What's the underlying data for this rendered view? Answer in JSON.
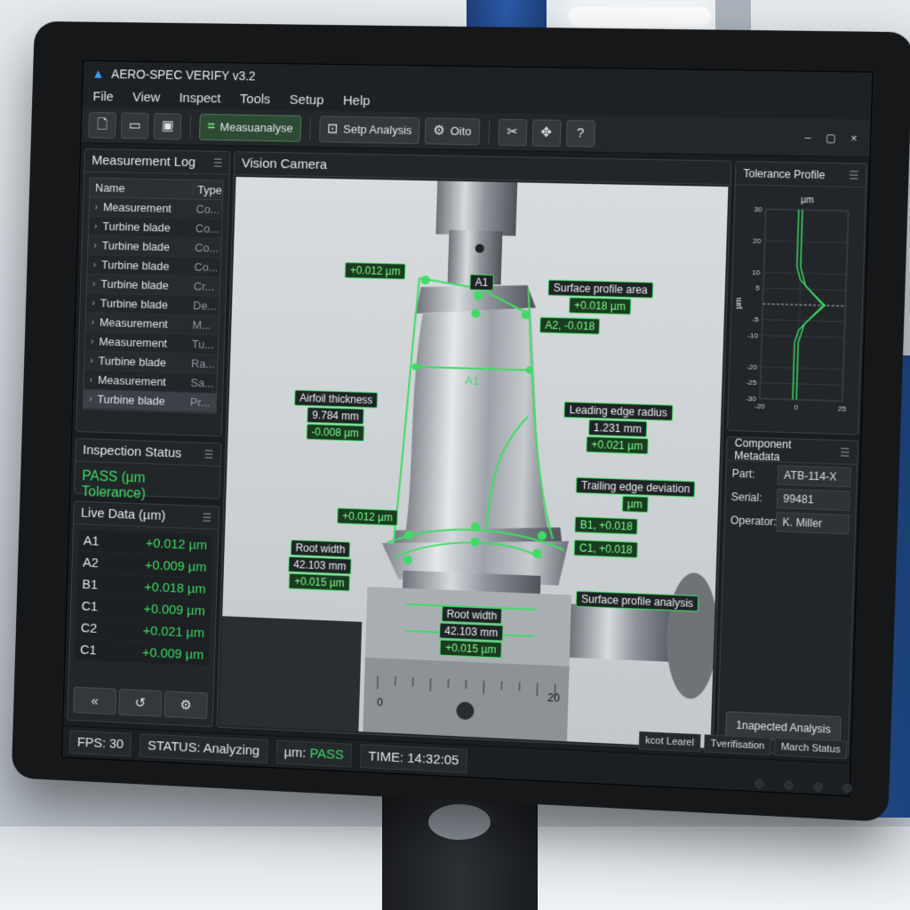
{
  "app": {
    "title": "AERO-SPEC VERIFY v3.2"
  },
  "menu": [
    "File",
    "View",
    "Inspect",
    "Tools",
    "Setup",
    "Help"
  ],
  "toolbar": {
    "measure_label": "Measuanalyse",
    "setup_label": "Setp Analysis",
    "auto_label": "Oito"
  },
  "window_controls": {
    "minimize": "–",
    "maximize": "▢",
    "close": "×"
  },
  "measurement_log": {
    "title": "Measurement Log",
    "col_name": "Name",
    "col_type": "Type",
    "rows": [
      {
        "name": "Measurement",
        "type": "Co..."
      },
      {
        "name": "Turbine blade",
        "type": "Co..."
      },
      {
        "name": "Turbine blade",
        "type": "Co..."
      },
      {
        "name": "Turbine blade",
        "type": "Co..."
      },
      {
        "name": "Turbine blade",
        "type": "Cr..."
      },
      {
        "name": "Turbine blade",
        "type": "De..."
      },
      {
        "name": "Measurement",
        "type": "M..."
      },
      {
        "name": "Measurement",
        "type": "Tu..."
      },
      {
        "name": "Turbine blade",
        "type": "Ra..."
      },
      {
        "name": "Measurement",
        "type": "Sa..."
      },
      {
        "name": "Turbine blade",
        "type": "Pr..."
      }
    ]
  },
  "inspection_status": {
    "title": "Inspection Status",
    "value": "PASS (µm Tolerance)"
  },
  "live_data": {
    "title": "Live Data (µm)",
    "rows": [
      {
        "key": "A1",
        "value": "+0.012 µm"
      },
      {
        "key": "A2",
        "value": "+0.009 µm"
      },
      {
        "key": "B1",
        "value": "+0.018 µm"
      },
      {
        "key": "C1",
        "value": "+0.009 µm"
      },
      {
        "key": "C2",
        "value": "+0.021 µm"
      },
      {
        "key": "C1",
        "value": "+0.009 µm"
      }
    ]
  },
  "camera": {
    "title": "Vision Camera",
    "annotations": {
      "a1_dev": "+0.012 µm",
      "a1_label": "A1",
      "a1_mid": "A1",
      "surface_area_title": "Surface profile area",
      "surface_area_val": "+0.018 µm",
      "a2": "A2, -0.018",
      "airfoil_title": "Airfoil thickness",
      "airfoil_mm": "9.784 mm",
      "airfoil_dev": "-0.008 µm",
      "leading_title": "Leading edge radius",
      "leading_mm": "1.231 mm",
      "leading_dev": "+0.021 µm",
      "trailing_title": "Trailing edge deviation",
      "trailing_unit": "µm",
      "left_dev": "+0.012 µm",
      "b1": "B1, +0.018",
      "c1": "C1, +0.018",
      "root_left_title": "Root width",
      "root_left_mm": "42.103 mm",
      "root_left_dev": "+0.015 µm",
      "root_bottom_title": "Root width",
      "root_bottom_mm": "42.103 mm",
      "root_bottom_dev": "+0.015 µm",
      "surface_analysis": "Surface profile analysis",
      "ruler_0": "0",
      "ruler_20": "20"
    }
  },
  "tolerance_profile": {
    "title": "Tolerance Profile",
    "unit": "µm",
    "ylabel": "µm",
    "chart_data": {
      "type": "line",
      "title": "Tolerance Profile",
      "xlabel": "µm",
      "ylabel": "µm",
      "xlim": [
        -20,
        25
      ],
      "ylim": [
        -30,
        30
      ],
      "x_ticks": [
        "-20",
        "0",
        "25"
      ],
      "y_ticks": [
        "30",
        "20",
        "10",
        "5",
        "-5",
        "-10",
        "-20",
        "-25",
        "-30"
      ],
      "series": [
        {
          "values_xy": [
            [
              -2,
              30
            ],
            [
              -2,
              12
            ],
            [
              0,
              8
            ],
            [
              8,
              3
            ],
            [
              13,
              0
            ],
            [
              8,
              -3
            ],
            [
              0,
              -8
            ],
            [
              -2,
              -12
            ],
            [
              -2,
              -30
            ]
          ]
        },
        {
          "values_xy": [
            [
              0,
              30
            ],
            [
              0,
              12
            ],
            [
              3,
              6
            ],
            [
              12,
              1
            ],
            [
              14,
              0
            ],
            [
              12,
              -1
            ],
            [
              3,
              -6
            ],
            [
              0,
              -12
            ],
            [
              0,
              -30
            ]
          ]
        }
      ]
    }
  },
  "metadata": {
    "title": "Component Metadata",
    "part_label": "Part:",
    "part": "ATB-114-X",
    "serial_label": "Serial:",
    "serial": "99481",
    "operator_label": "Operator:",
    "operator": "K. Miller",
    "button": "1napected Analysis"
  },
  "bottom_right": {
    "a": "kcot Learel",
    "b": "Tverifisation",
    "c": "March Status"
  },
  "status": {
    "fps": "FPS: 30",
    "state": "STATUS: Analyzing",
    "um_label": "µm:",
    "um_value": "PASS",
    "time": "TIME: 14:32:05"
  },
  "colors": {
    "accent": "#3ddc63",
    "background": "#1a1d20"
  }
}
